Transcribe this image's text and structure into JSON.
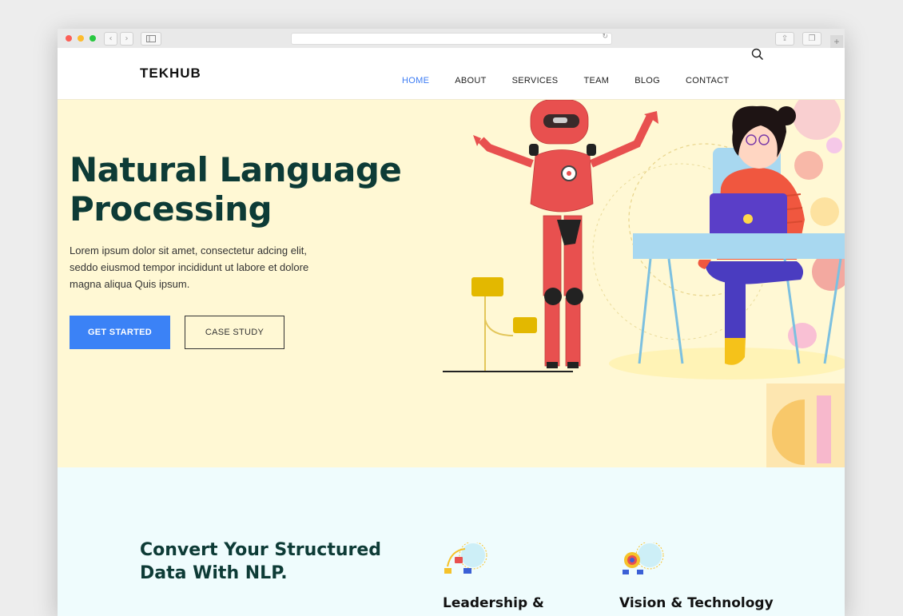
{
  "browser": {
    "back_icon": "chevron-left-icon",
    "forward_icon": "chevron-right-icon",
    "sidebar_icon": "sidebar-icon",
    "reload_icon": "reload-icon",
    "share_icon": "share-icon",
    "tabs_icon": "tabs-icon",
    "new_tab_icon": "plus-icon"
  },
  "header": {
    "brand": "TEKHUB",
    "nav": [
      {
        "label": "HOME",
        "active": true
      },
      {
        "label": "ABOUT",
        "active": false
      },
      {
        "label": "SERVICES",
        "active": false
      },
      {
        "label": "TEAM",
        "active": false
      },
      {
        "label": "BLOG",
        "active": false
      },
      {
        "label": "CONTACT",
        "active": false
      }
    ],
    "search_icon": "search-icon"
  },
  "hero": {
    "title_line1": "Natural Language",
    "title_line2": "Processing",
    "text": "Lorem ipsum dolor sit amet, consectetur adcing elit, seddo eiusmod tempor incididunt ut labore et dolore magna aliqua Quis ipsum.",
    "primary_button": "GET STARTED",
    "secondary_button": "CASE STUDY",
    "illustration": "robot-and-person-illustration"
  },
  "features": {
    "title_line1": "Convert Your Structured",
    "title_line2": "Data With NLP.",
    "cards": [
      {
        "title": "Leadership &",
        "icon": "leadership-icon"
      },
      {
        "title": "Vision & Technology",
        "icon": "vision-icon"
      }
    ]
  },
  "colors": {
    "accent": "#3b82f6",
    "nav_active": "#3b7bf4",
    "heading": "#0d3b36",
    "hero_bg": "#fff8d4",
    "features_bg": "#effcfd",
    "robot": "#e8504f"
  }
}
